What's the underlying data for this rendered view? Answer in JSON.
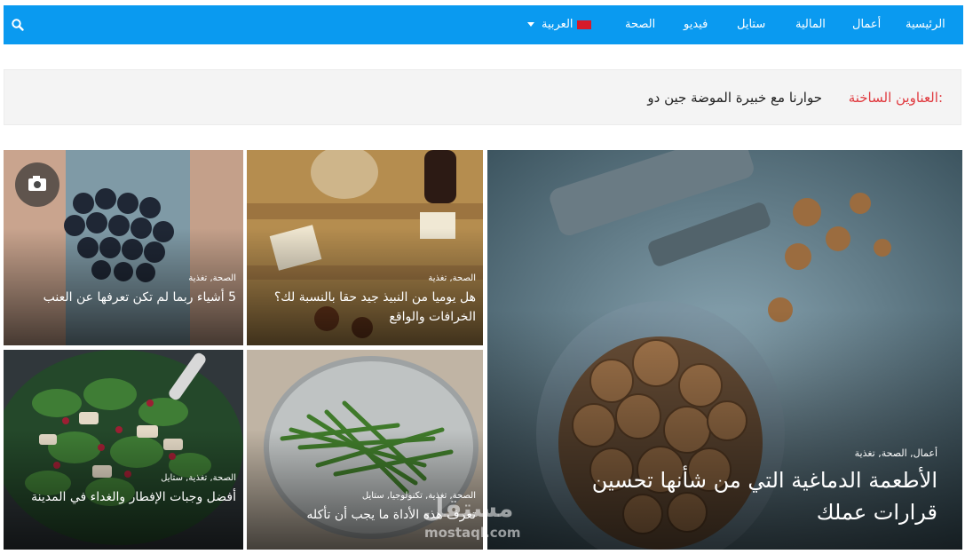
{
  "nav": {
    "items": [
      "الرئيسية",
      "أعمال",
      "المالية",
      "ستايل",
      "فيديو",
      "الصحة"
    ],
    "language": "العربية"
  },
  "breaking": {
    "label": "العناوين الساخنة:",
    "text": "حوارنا مع خبيرة الموضة جين دو"
  },
  "featured": {
    "categories": "أعمال, الصحة, تغذية",
    "title": "الأطعمة الدماغية التي من شأنها تحسين قرارات عملك"
  },
  "posts": [
    {
      "categories": "الصحة, تغذية",
      "title": "هل يوميا من النبيذ جيد حقا بالنسبة لك؟ الخرافات والواقع"
    },
    {
      "categories": "الصحة, تغذية",
      "title": "5 أشياء ربما لم تكن تعرفها عن العنب"
    },
    {
      "categories": "الصحة, تغذية, تكنولوجيا, ستايل",
      "title": "تعرف هذه الأداة ما يجب أن تأكله"
    },
    {
      "categories": "الصحة, تغذية, ستايل",
      "title": "أفضل وجبات الإفطار والغداء في المدينة"
    }
  ],
  "watermark": {
    "text": "مستقل",
    "sub": "mostaql.com"
  },
  "colors": {
    "nav": "#0a9af0",
    "breaking_label": "#e0393e"
  },
  "icons": [
    "search-icon",
    "flag-icon",
    "chevron-down-icon",
    "camera-icon"
  ]
}
